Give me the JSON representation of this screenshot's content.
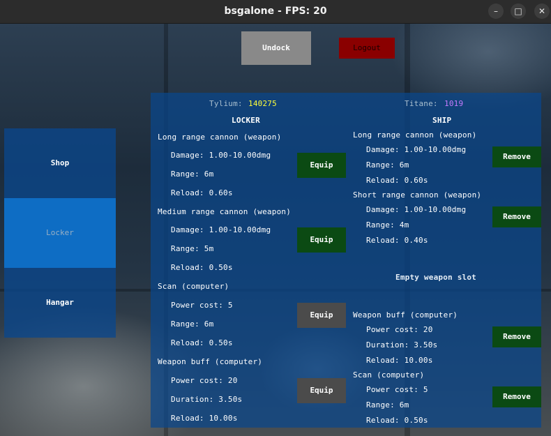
{
  "window": {
    "title": "bsgalone - FPS: 20"
  },
  "topbar": {
    "undock": "Undock",
    "logout": "Logout"
  },
  "menu": {
    "shop": "Shop",
    "locker": "Locker",
    "hangar": "Hangar"
  },
  "resources": {
    "tylium_label": "Tylium:",
    "tylium_value": "140275",
    "tylium_color": "#ffff3a",
    "titane_label": "Titane:",
    "titane_value": "1019",
    "titane_color": "#c77bff"
  },
  "locker": {
    "title": "LOCKER",
    "equip_label": "Equip",
    "items": [
      {
        "name": "Long range cannon (weapon)",
        "props": [
          "Damage: 1.00-10.00dmg",
          "Range: 6m",
          "Reload: 0.60s"
        ]
      },
      {
        "name": "Medium range cannon (weapon)",
        "props": [
          "Damage: 1.00-10.00dmg",
          "Range: 5m",
          "Reload: 0.50s"
        ]
      },
      {
        "name": "Scan (computer)",
        "props": [
          "Power cost: 5",
          "Range: 6m",
          "Reload: 0.50s"
        ]
      },
      {
        "name": "Weapon buff (computer)",
        "props": [
          "Power cost: 20",
          "Duration: 3.50s",
          "Reload: 10.00s"
        ]
      }
    ]
  },
  "ship": {
    "title": "SHIP",
    "remove_label": "Remove",
    "items": [
      {
        "name": "Long range cannon (weapon)",
        "props": [
          "Damage: 1.00-10.00dmg",
          "Range: 6m",
          "Reload: 0.60s"
        ]
      },
      {
        "name": "Short range cannon (weapon)",
        "props": [
          "Damage: 1.00-10.00dmg",
          "Range: 4m",
          "Reload: 0.40s"
        ]
      },
      {
        "name": "Weapon buff (computer)",
        "props": [
          "Power cost: 20",
          "Duration: 3.50s",
          "Reload: 10.00s"
        ]
      },
      {
        "name": "Scan (computer)",
        "props": [
          "Power cost: 5",
          "Range: 6m",
          "Reload: 0.50s"
        ]
      }
    ],
    "empty_slot": "Empty weapon slot"
  }
}
